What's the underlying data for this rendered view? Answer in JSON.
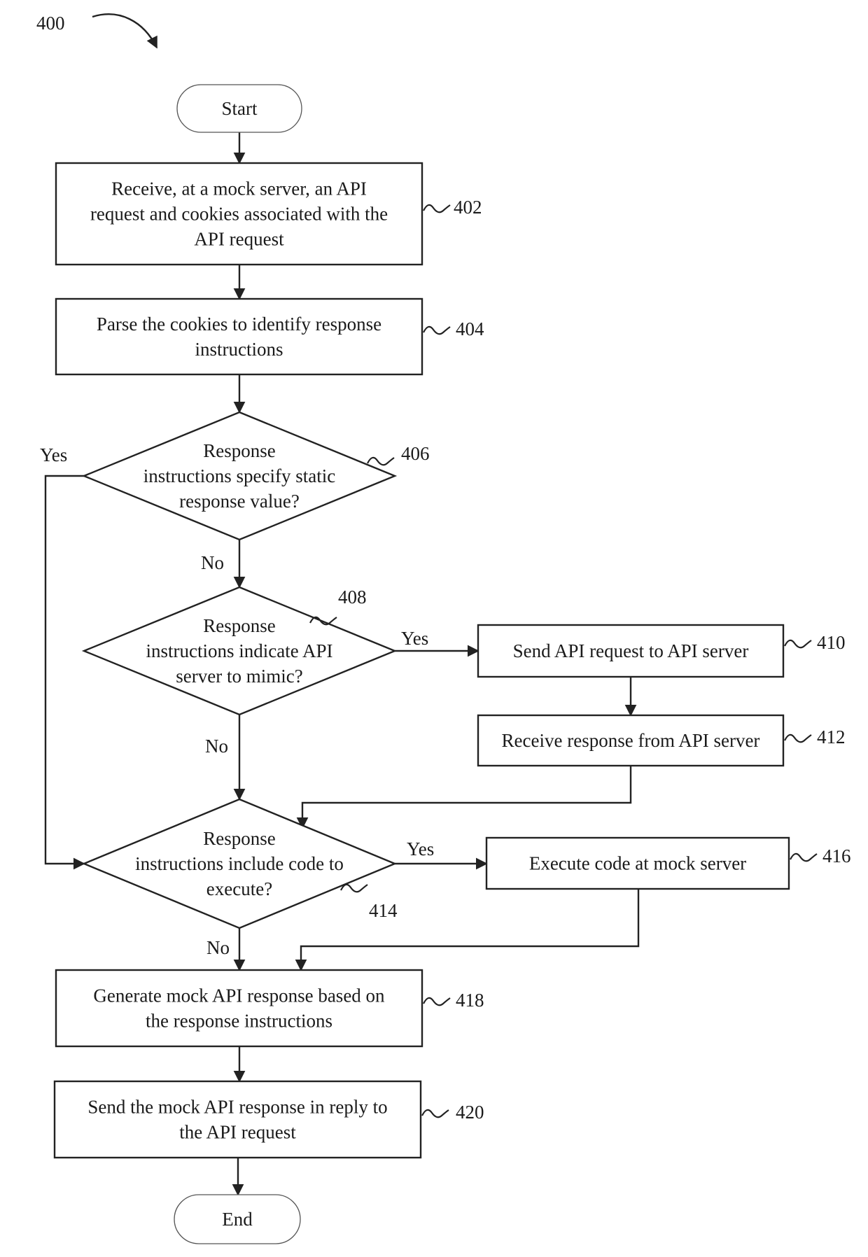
{
  "figure": {
    "number": "400"
  },
  "nodes": {
    "start": {
      "type": "terminal",
      "text": [
        "Start"
      ]
    },
    "n402": {
      "type": "process",
      "ref": "402",
      "text": [
        "Receive, at a mock server,  an API",
        "request and cookies associated with the",
        "API request"
      ]
    },
    "n404": {
      "type": "process",
      "ref": "404",
      "text": [
        "Parse the cookies to identify response",
        "instructions"
      ]
    },
    "n406": {
      "type": "decision",
      "ref": "406",
      "text": [
        "Response",
        "instructions specify static",
        "response value?"
      ]
    },
    "n408": {
      "type": "decision",
      "ref": "408",
      "text": [
        "Response",
        "instructions indicate API",
        "server to mimic?"
      ]
    },
    "n410": {
      "type": "process",
      "ref": "410",
      "text": [
        "Send API request to API server"
      ]
    },
    "n412": {
      "type": "process",
      "ref": "412",
      "text": [
        "Receive response from API server"
      ]
    },
    "n414": {
      "type": "decision",
      "ref": "414",
      "text": [
        "Response",
        "instructions include code to",
        "execute?"
      ]
    },
    "n416": {
      "type": "process",
      "ref": "416",
      "text": [
        "Execute code at mock server"
      ]
    },
    "n418": {
      "type": "process",
      "ref": "418",
      "text": [
        "Generate mock API response based on",
        "the response instructions"
      ]
    },
    "n420": {
      "type": "process",
      "ref": "420",
      "text": [
        "Send the mock API response in reply to",
        "the API request"
      ]
    },
    "end": {
      "type": "terminal",
      "text": [
        "End"
      ]
    }
  },
  "edges": [
    {
      "from": "start",
      "to": "n402",
      "label": ""
    },
    {
      "from": "n402",
      "to": "n404",
      "label": ""
    },
    {
      "from": "n404",
      "to": "n406",
      "label": ""
    },
    {
      "from": "n406",
      "to": "n414",
      "label": "Yes"
    },
    {
      "from": "n406",
      "to": "n408",
      "label": "No"
    },
    {
      "from": "n408",
      "to": "n410",
      "label": "Yes"
    },
    {
      "from": "n408",
      "to": "n414",
      "label": "No"
    },
    {
      "from": "n410",
      "to": "n412",
      "label": ""
    },
    {
      "from": "n412",
      "to": "n414",
      "label": ""
    },
    {
      "from": "n414",
      "to": "n416",
      "label": "Yes"
    },
    {
      "from": "n414",
      "to": "n418",
      "label": "No"
    },
    {
      "from": "n416",
      "to": "n418",
      "label": ""
    },
    {
      "from": "n418",
      "to": "n420",
      "label": ""
    },
    {
      "from": "n420",
      "to": "end",
      "label": ""
    }
  ],
  "branch_labels": {
    "yes": "Yes",
    "no": "No"
  }
}
